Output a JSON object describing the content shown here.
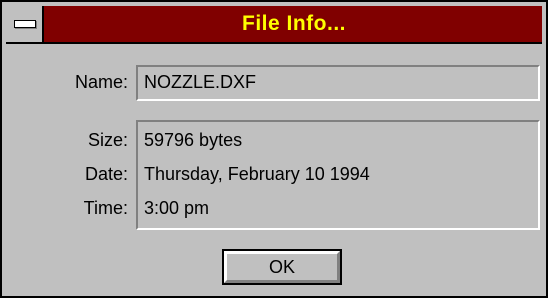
{
  "window": {
    "title": "File Info...",
    "system_menu_icon": "system-menu-icon"
  },
  "fields": {
    "name_label": "Name:",
    "name_value": "NOZZLE.DXF",
    "size_label": "Size:",
    "size_value": "59796 bytes",
    "date_label": "Date:",
    "date_value": "Thursday, February 10 1994",
    "time_label": "Time:",
    "time_value": "3:00 pm"
  },
  "buttons": {
    "ok_label": "OK"
  },
  "colors": {
    "title_bar": "#800000",
    "title_text": "#ffff00",
    "face": "#c0c0c0"
  }
}
